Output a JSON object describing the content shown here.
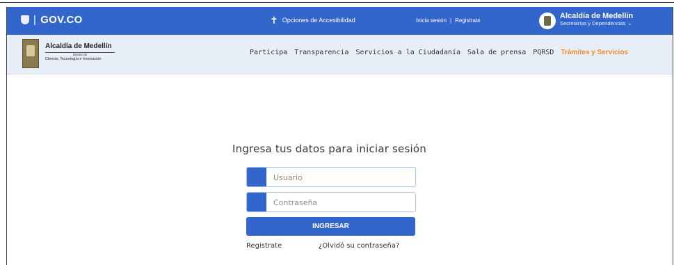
{
  "govbar": {
    "logo_text": "GOV.CO",
    "logo_separator": "|",
    "accessibility_label": "Opciones de Accesibilidad",
    "login_label": "Inicia sesión",
    "auth_separator": "|",
    "register_label": "Registrate",
    "entity_title": "Alcaldía de Medellín",
    "entity_subtitle": "Secretarías y Dependencias"
  },
  "header": {
    "brand_title": "Alcaldía de Medellín",
    "brand_small": "Distrito de",
    "brand_dept": "Ciencia, Tecnología e Innovación",
    "menu": [
      {
        "label": "Participa"
      },
      {
        "label": "Transparencia"
      },
      {
        "label": "Servicios a la Ciudadanía"
      },
      {
        "label": "Sala de prensa"
      },
      {
        "label": "PQRSD"
      },
      {
        "label": "Trámites y Servicios",
        "active": true
      }
    ]
  },
  "login": {
    "title": "Ingresa tus datos para iniciar sesión",
    "username_placeholder": "Usuario",
    "password_placeholder": "Contraseña",
    "submit_label": "INGRESAR",
    "register_link": "Registrate",
    "forgot_link": "¿Olvidó su contraseña?"
  },
  "colors": {
    "primary": "#3366cc",
    "accent": "#f28a2b",
    "nav_background": "#e8eef8"
  }
}
